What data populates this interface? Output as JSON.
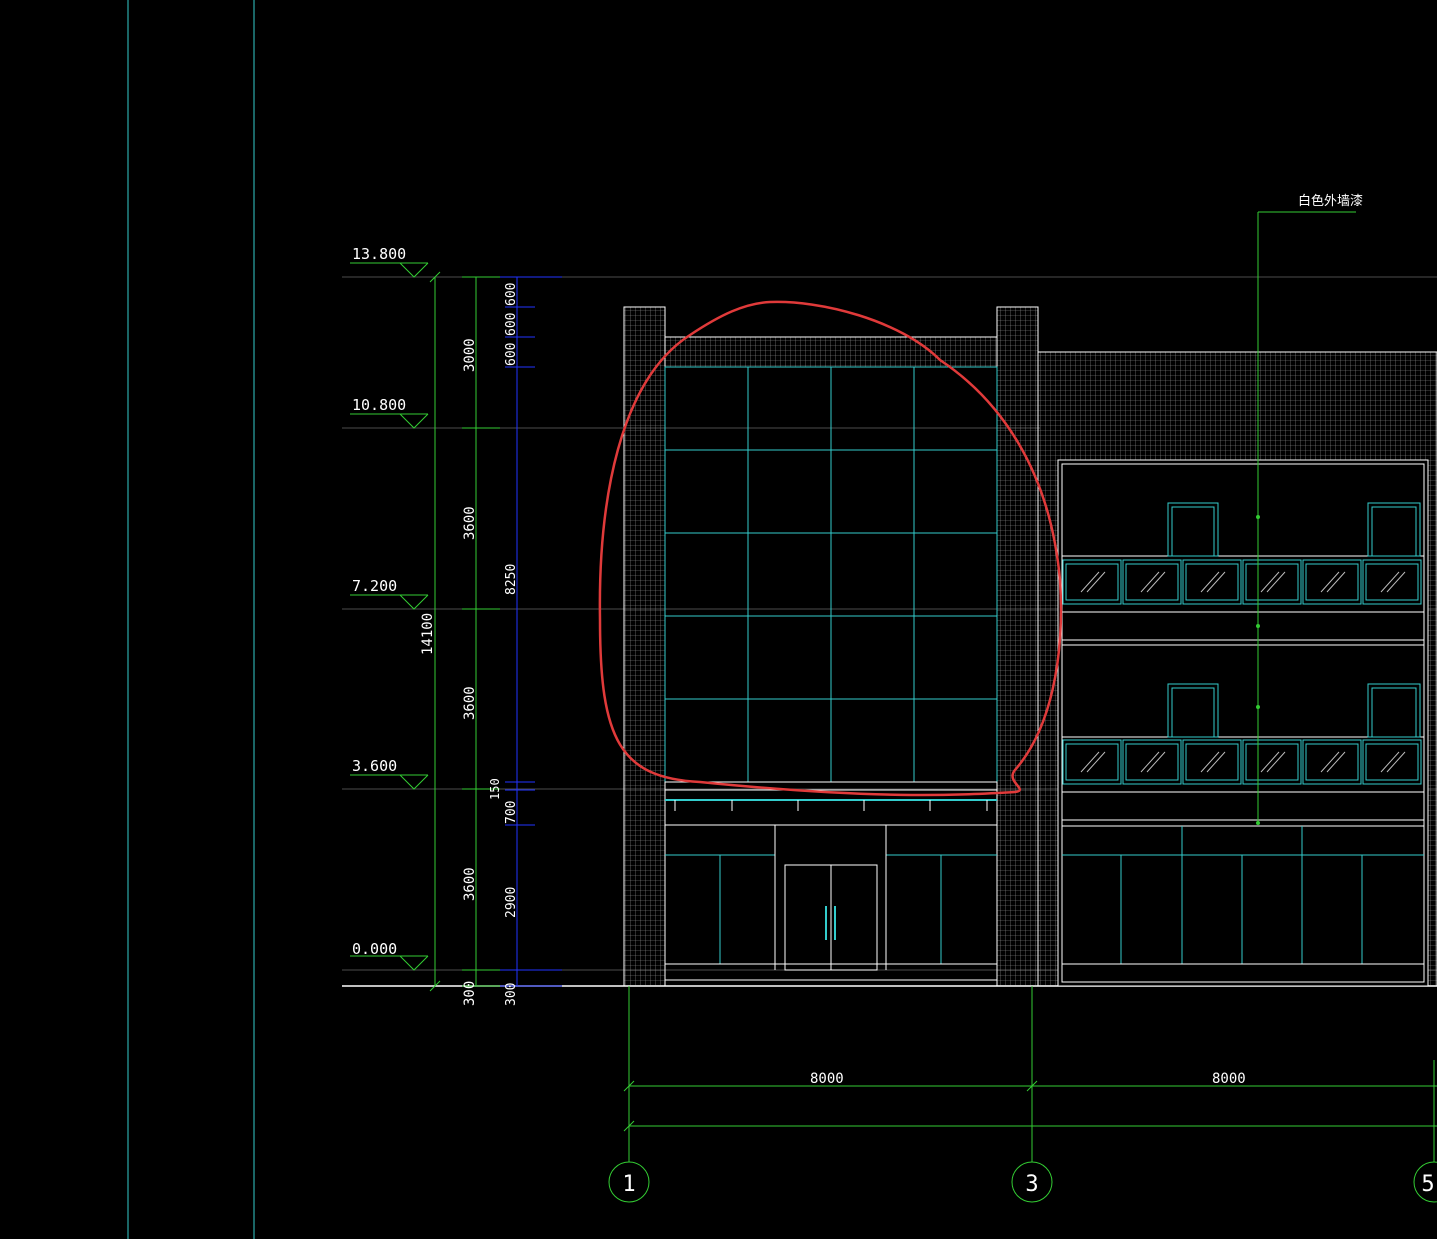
{
  "levels": [
    {
      "label": "13.800"
    },
    {
      "label": "10.800"
    },
    {
      "label": "7.200"
    },
    {
      "label": "3.600"
    },
    {
      "label": "0.000"
    }
  ],
  "dims_outer": {
    "total": "14100",
    "segments": [
      "3000",
      "3600",
      "3600",
      "3600",
      "300"
    ]
  },
  "dims_inner": {
    "segments": [
      "600",
      "600",
      "600",
      "8250",
      "150",
      "700",
      "2900",
      "300"
    ]
  },
  "horizontal_dims": [
    "8000",
    "8000"
  ],
  "grid_axes": [
    "1",
    "3",
    "5"
  ],
  "annotation": {
    "text": "白色外墙漆"
  },
  "colors": {
    "background": "#000000",
    "dimension": "#33cc33",
    "dimension_blue": "#2233ff",
    "glass": "#33cccc",
    "outline": "#ffffff",
    "markup": "#e03a3a"
  }
}
